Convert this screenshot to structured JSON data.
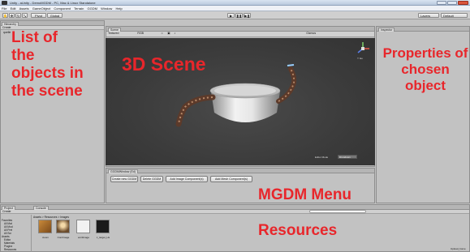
{
  "window": {
    "title": "Unity - aUnity - DemoMGDM - PC, Mac & Linux Standalone"
  },
  "menu": [
    "File",
    "Edit",
    "Assets",
    "GameObject",
    "Component",
    "Terrain",
    "GGDM",
    "Window",
    "Help"
  ],
  "toolbar": {
    "pivot": "Pivot",
    "center": "Center",
    "global": "Global",
    "layers": "Layers",
    "layout": "Default",
    "play_icons": [
      "play-icon",
      "pause-icon",
      "step-icon"
    ]
  },
  "hierarchy": {
    "tab": "Hierarchy",
    "create": "Create",
    "item": "quelle"
  },
  "scene": {
    "tab": "Scene",
    "shading": "Textured",
    "rgb": "RGB",
    "gizmos": "Gizmos",
    "gizmo_label": "Y Iso",
    "status": "Editor Mode",
    "status_value": "Dropdown"
  },
  "mgdm": {
    "tab": "GGDMWindow (Ed)",
    "buttons": [
      "Create new GGDM",
      "Delete GGDM",
      "Add Image Component(s)",
      "Add Mesh Component(s)"
    ]
  },
  "inspector": {
    "tab": "Inspector"
  },
  "project": {
    "tabs": [
      "Project",
      "Console"
    ],
    "create": "Create",
    "breadcrumb": "Assets > Resources > Images",
    "tree": [
      "Favorites",
      "All Mat",
      "All Mod",
      "All Pref",
      "All Scr",
      "Assets",
      "Editor",
      "Materials",
      "Plugins",
      "Resources",
      "Images"
    ],
    "assets": [
      "Aoom",
      "ContImage",
      "emitImage",
      "z_target_Hs"
    ],
    "footer": "Upload_home"
  },
  "annotations": {
    "hierarchy_note": "List of the objects in the scene",
    "scene_label": "3D Scene",
    "inspector_note": "Properties of chosen object",
    "mgdm_label": "MGDM Menu",
    "resources_label": "Resources"
  },
  "colors": {
    "annotation": "#e8262b",
    "scene_bg": "#3b3b3b",
    "panel_bg": "#c2c2c2"
  }
}
